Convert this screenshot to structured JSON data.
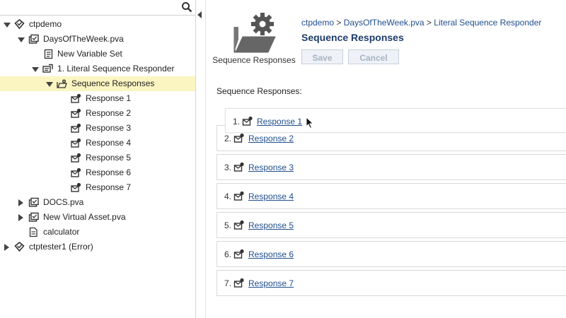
{
  "tree": {
    "root1": "ctpdemo",
    "asset1": "DaysOfTheWeek.pva",
    "new_var": "New Variable Set",
    "responder": "1. Literal Sequence Responder",
    "seq_responses": "Sequence Responses",
    "responses": [
      "Response 1",
      "Response 2",
      "Response 3",
      "Response 4",
      "Response 5",
      "Response 6",
      "Response 7"
    ],
    "docs": "DOCS.pva",
    "new_va": "New Virtual Asset.pva",
    "calc": "calculator",
    "root2": "ctptester1 (Error)"
  },
  "header": {
    "icon_label": "Sequence Responses",
    "crumb1": "ctpdemo",
    "sep": ">",
    "crumb2": "DaysOfTheWeek.pva",
    "crumb3": "Literal Sequence Responder",
    "title": "Sequence Responses",
    "save": "Save",
    "cancel": "Cancel"
  },
  "section_label": "Sequence Responses:",
  "list": [
    {
      "num": "1.",
      "label": "Response 1"
    },
    {
      "num": "2.",
      "label": "Response 2"
    },
    {
      "num": "3.",
      "label": "Response 3"
    },
    {
      "num": "4.",
      "label": "Response 4"
    },
    {
      "num": "5.",
      "label": "Response 5"
    },
    {
      "num": "6.",
      "label": "Response 6"
    },
    {
      "num": "7.",
      "label": "Response 7"
    }
  ],
  "icons": {
    "search": "search-icon",
    "folder_gear": "folder-gear-icon",
    "response": "envelope-response-icon"
  },
  "colors": {
    "selected_bg": "#fbf5c2",
    "link": "#1f4e8c",
    "title": "#1e3c6b"
  }
}
